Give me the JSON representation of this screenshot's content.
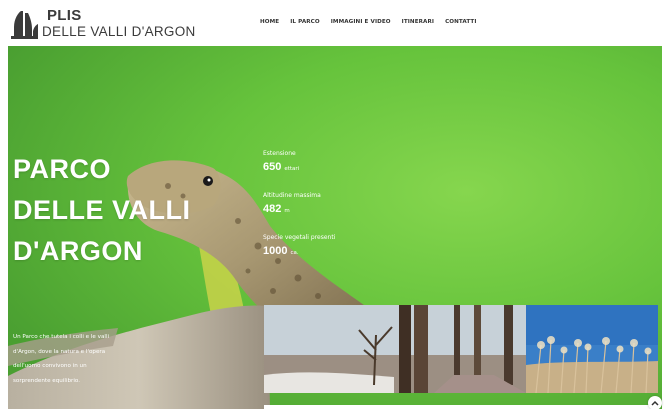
{
  "header": {
    "logo_title": "PLIS",
    "logo_subtitle": "DELLE VALLI D'ARGON",
    "nav": [
      {
        "label": "HOME"
      },
      {
        "label": "IL PARCO"
      },
      {
        "label": "IMMAGINI E VIDEO"
      },
      {
        "label": "ITINERARI"
      },
      {
        "label": "CONTATTI"
      }
    ]
  },
  "hero": {
    "title_lines": [
      "PARCO",
      "DELLE VALLI",
      "D'ARGON"
    ],
    "stats": [
      {
        "label": "Estensione",
        "value": "650",
        "unit": "ettari"
      },
      {
        "label": "Altitudine massima",
        "value": "482",
        "unit": "m"
      },
      {
        "label": "Specie vegetali presenti",
        "value": "1000",
        "unit": "ca."
      }
    ],
    "description_lines": [
      "Un Parco che tutela i colli e le valli",
      "d'Argon, dove la natura e l'opera",
      "dell'uomo convivono in un",
      "sorprendente equilibrio."
    ],
    "bg_color": "#62c13b"
  },
  "icons": {
    "logo": "tree-logo-icon",
    "scroll_top": "chevron-up-icon"
  }
}
